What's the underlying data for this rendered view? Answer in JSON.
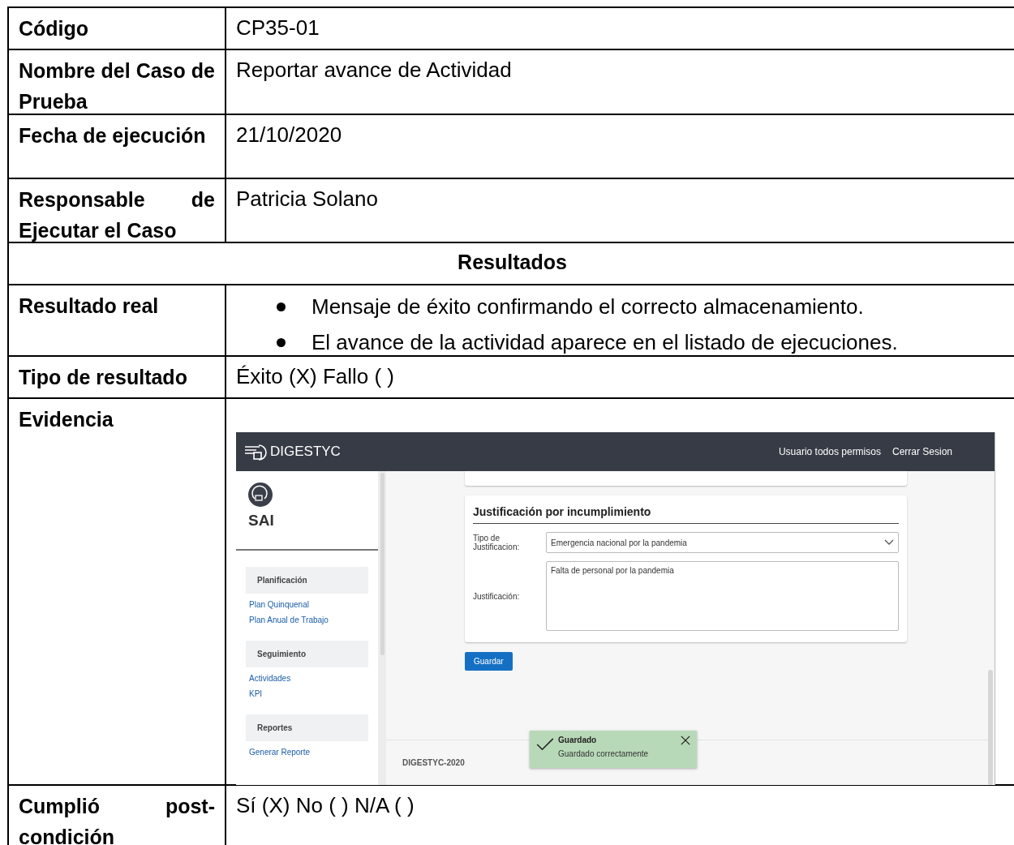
{
  "rows": [
    {
      "kind": "text",
      "label": "Código",
      "value": "CP35-01"
    },
    {
      "kind": "text",
      "label": "Nombre del Caso de Prueba",
      "value": "Reportar avance de Actividad"
    },
    {
      "kind": "text",
      "label": "Fecha de ejecución",
      "value": "21/10/2020"
    },
    {
      "kind": "text",
      "label": "Responsable de Ejecutar el Caso",
      "value": "Patricia Solano"
    },
    {
      "kind": "heading",
      "label": "Resultados"
    },
    {
      "kind": "bullets",
      "label": "Resultado real",
      "items": [
        "Mensaje de éxito confirmando el correcto almacenamiento.",
        "El avance de la actividad aparece en el listado de ejecuciones."
      ]
    },
    {
      "kind": "text",
      "label": "Tipo de resultado",
      "value": "Éxito (X) Fallo ( )"
    },
    {
      "kind": "screenshot",
      "label": "Evidencia"
    },
    {
      "kind": "text",
      "label": "Cumplió post-condición",
      "value": "Sí (X) No ( )  N/A ( )"
    }
  ],
  "screenshot": {
    "logo": "DIGESTYC",
    "user": "Usuario todos permisos",
    "logout": "Cerrar Sesion",
    "app_name": "SAI",
    "nav": [
      {
        "title": "Planificación",
        "items": [
          "Plan Quinquenal",
          "Plan Anual de Trabajo"
        ]
      },
      {
        "title": "Seguimiento",
        "items": [
          "Actividades",
          "KPI"
        ]
      },
      {
        "title": "Reportes",
        "items": [
          "Generar Reporte"
        ]
      }
    ],
    "form": {
      "title": "Justificación por incumplimiento",
      "type_label": "Tipo de Justificacion:",
      "type_value": "Emergencia nacional por la pandemia",
      "justification_label": "Justificación:",
      "justification_value": "Falta de personal por la pandemia",
      "save": "Guardar"
    },
    "footer": "DIGESTYC-2020",
    "toast": {
      "title": "Guardado",
      "message": "Guardado correctamente"
    }
  }
}
